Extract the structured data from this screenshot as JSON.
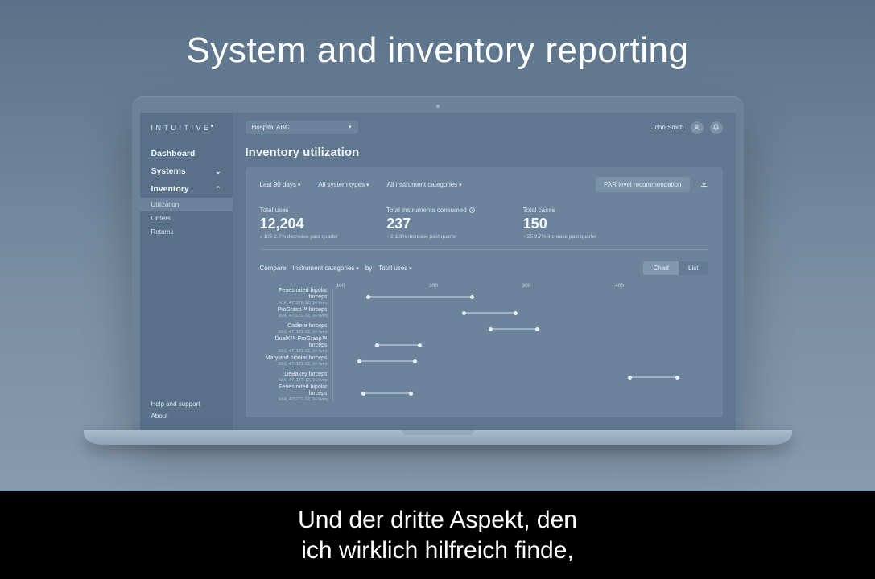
{
  "headline": "System and inventory reporting",
  "brand": "INTUITIVE",
  "sidebar": {
    "items": [
      {
        "label": "Dashboard",
        "expandable": false
      },
      {
        "label": "Systems",
        "expandable": true
      },
      {
        "label": "Inventory",
        "expandable": true
      }
    ],
    "inventory_sub": [
      {
        "label": "Utilization",
        "active": true
      },
      {
        "label": "Orders",
        "active": false
      },
      {
        "label": "Returns",
        "active": false
      }
    ],
    "help": "Help and support",
    "about": "About"
  },
  "topbar": {
    "hospital": "Hospital ABC",
    "user": "John Smith"
  },
  "page_title": "Inventory utilization",
  "filters": {
    "date": "Last 90 days",
    "system": "All system types",
    "category": "All instrument categories",
    "par_button": "PAR level recommendation"
  },
  "stats": [
    {
      "label": "Total uses",
      "value": "12,204",
      "delta": "↓ 105  2.7% decrease past quarter"
    },
    {
      "label": "Total instruments consumed",
      "value": "237",
      "delta": "↑ 2  1.9% increase past quarter",
      "info": true
    },
    {
      "label": "Total cases",
      "value": "150",
      "delta": "↑ 25  9.7% increase past quarter"
    }
  ],
  "compare": {
    "label": "Compare",
    "dim": "Instrument categories",
    "by_label": "by",
    "metric": "Total uses",
    "toggle": {
      "chart": "Chart",
      "list": "List",
      "active": "chart"
    }
  },
  "chart_data": {
    "type": "bar",
    "axis_ticks": [
      100,
      200,
      300,
      400
    ],
    "xmax": 430,
    "series_meta": "XdX, 471172-12, 14 lives",
    "rows": [
      {
        "name": "Fenestrated bipolar forceps",
        "low": 40,
        "high": 160
      },
      {
        "name": "ProGrasp™ forceps",
        "low": 150,
        "high": 210
      },
      {
        "name": "Cadiere forceps",
        "low": 180,
        "high": 235
      },
      {
        "name": "DualX™ ProGrasp™ forceps",
        "low": 50,
        "high": 100
      },
      {
        "name": "Maryland bipolar forceps",
        "low": 30,
        "high": 95
      },
      {
        "name": "DeBakey forceps",
        "low": 340,
        "high": 395
      },
      {
        "name": "Fenestrated bipolar forceps",
        "low": 35,
        "high": 90
      }
    ]
  },
  "caption": "Und der dritte Aspekt, den\nich wirklich hilfreich finde,"
}
